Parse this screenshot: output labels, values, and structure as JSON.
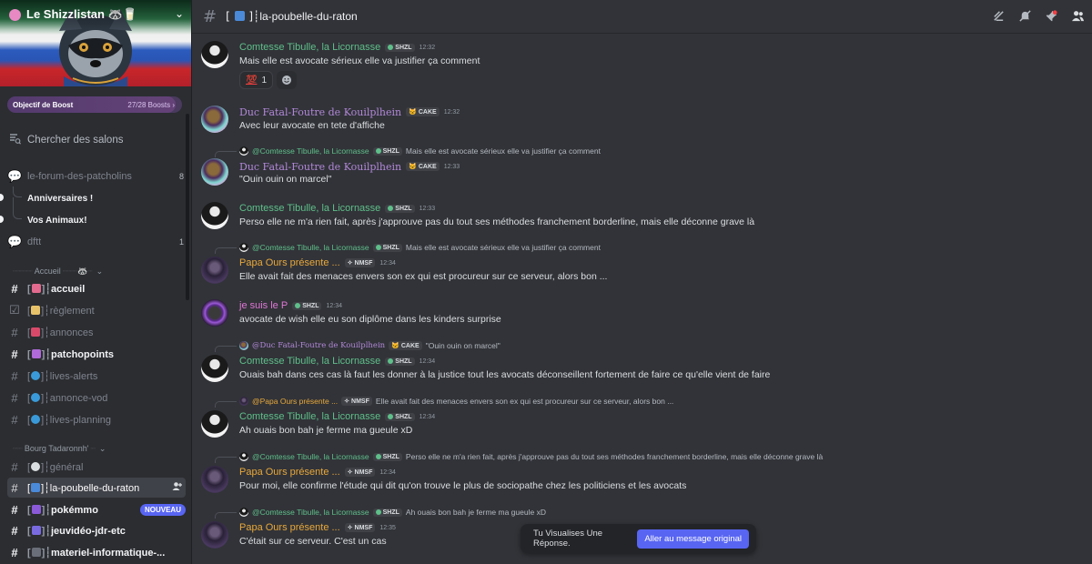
{
  "server": {
    "name": "Le Shizzlistan 🦝🥛"
  },
  "boost": {
    "label": "Objectif de Boost",
    "count": "27/28 Boosts",
    "progress": 0.964
  },
  "search": {
    "label": "Chercher des salons"
  },
  "forum_items": [
    {
      "label": "le-forum-des-patcholins",
      "count": "8"
    },
    {
      "label": "Anniversaires !"
    },
    {
      "label": "Vos Animaux!"
    },
    {
      "label": "dftt",
      "count": "1"
    }
  ],
  "categories": {
    "accueil": "Accueil",
    "bourg": "Bourg Tadaronnh'"
  },
  "channels": [
    {
      "label": "accueil"
    },
    {
      "label": "règlement"
    },
    {
      "label": "annonces"
    },
    {
      "label": "patchopoints"
    },
    {
      "label": "lives-alerts"
    },
    {
      "label": "annonce-vod"
    },
    {
      "label": "lives-planning"
    },
    {
      "label": "général"
    },
    {
      "label": "la-poubelle-du-raton"
    },
    {
      "label": "pokémmo",
      "badge": "NOUVEAU"
    },
    {
      "label": "jeuvidéo-jdr-etc"
    },
    {
      "label": "materiel-informatique-..."
    }
  ],
  "topbar": {
    "title": "┊la-poubelle-du-raton"
  },
  "names": {
    "tibulle": "Comtesse Tibulle, la Licornasse",
    "duc": "Duc Fatal-Foutre de Kouilplhein",
    "papa": "Papa Ours présente ...",
    "jesuis": "je suis le P",
    "at_tibulle": "@Comtesse Tibulle, la Licornasse",
    "at_duc": "@Duc Fatal-Foutre de Kouilplhein",
    "at_papa": "@Papa Ours présente ..."
  },
  "tags": {
    "shzl": "SHZL",
    "cake": "CAKE",
    "nmsf": "NMSF"
  },
  "messages": [
    {
      "time": "12:32",
      "text": "Mais elle est avocate sérieux elle va justifier ça comment",
      "reaction_count": "1"
    },
    {
      "time": "12:32",
      "text": "Avec leur avocate en tete d'affiche"
    },
    {
      "reply_text": "Mais elle est avocate sérieux elle va justifier ça comment",
      "time": "12:33",
      "text": "\"Ouin ouin on marcel\""
    },
    {
      "time": "12:33",
      "text": "Perso elle ne m'a rien fait, après j'approuve pas du tout ses méthodes franchement borderline, mais elle déconne grave là"
    },
    {
      "reply_text": "Mais elle est avocate sérieux elle va justifier ça comment",
      "time": "12:34",
      "text": "Elle avait fait des menaces envers son ex qui est procureur sur ce serveur, alors bon ..."
    },
    {
      "time": "12:34",
      "text": "avocate de wish elle eu son diplôme dans les kinders surprise"
    },
    {
      "reply_text": "\"Ouin ouin on marcel\"",
      "time": "12:34",
      "text": "Ouais bah dans ces cas là faut les donner à la justice tout les avocats déconseillent fortement de faire ce qu'elle vient de faire"
    },
    {
      "reply_text": "Elle avait fait des menaces envers son ex qui est procureur sur ce serveur, alors bon ...",
      "time": "12:34",
      "text": "Ah ouais bon bah je ferme ma gueule xD"
    },
    {
      "reply_text": "Perso elle ne m'a rien fait, après j'approuve pas du tout ses méthodes franchement borderline, mais elle déconne grave là",
      "time": "12:34",
      "text": "Pour moi, elle confirme l'étude qui dit qu'on trouve le plus de sociopathe chez les politiciens et les avocats"
    },
    {
      "reply_text": "Ah ouais bon bah je ferme ma gueule xD",
      "time": "12:35",
      "text": "C'était sur ce serveur. C'est un cas"
    }
  ],
  "reply_bar": {
    "text": "Tu Visualises Une Réponse.",
    "button": "Aller au message original"
  },
  "colors": {
    "accent": "#5865f2",
    "tibulle": "#5fbf8a",
    "duc": "#b388d9",
    "papa": "#e9a83a",
    "jesuis": "#e077d6"
  }
}
